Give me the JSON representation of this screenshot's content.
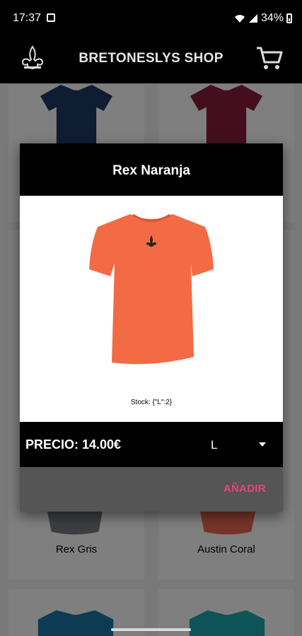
{
  "status_bar": {
    "time": "17:37",
    "battery": "34%"
  },
  "app_bar": {
    "title": "BRETONESLYS SHOP",
    "logo_icon": "fleur-de-lis-logo-icon",
    "cart_icon": "shopping-cart-icon"
  },
  "products": [
    {
      "name": "",
      "color": "#1d3a63"
    },
    {
      "name": "",
      "color": "#8a1c3c"
    },
    {
      "name": "Rex Gris",
      "color": "#7a7d82"
    },
    {
      "name": "Austin Coral",
      "color": "#ef6b55"
    },
    {
      "name": "",
      "color": "#1a77a6"
    },
    {
      "name": "",
      "color": "#1aa7b0"
    }
  ],
  "dialog": {
    "title": "Rex Naranja",
    "product_color": "#f26b45",
    "stock": "Stock: {\"L\":2}",
    "price": "PRECIO: 14.00€",
    "size_selected": "L",
    "add_label": "AÑADIR",
    "accent": "#e0467a"
  }
}
